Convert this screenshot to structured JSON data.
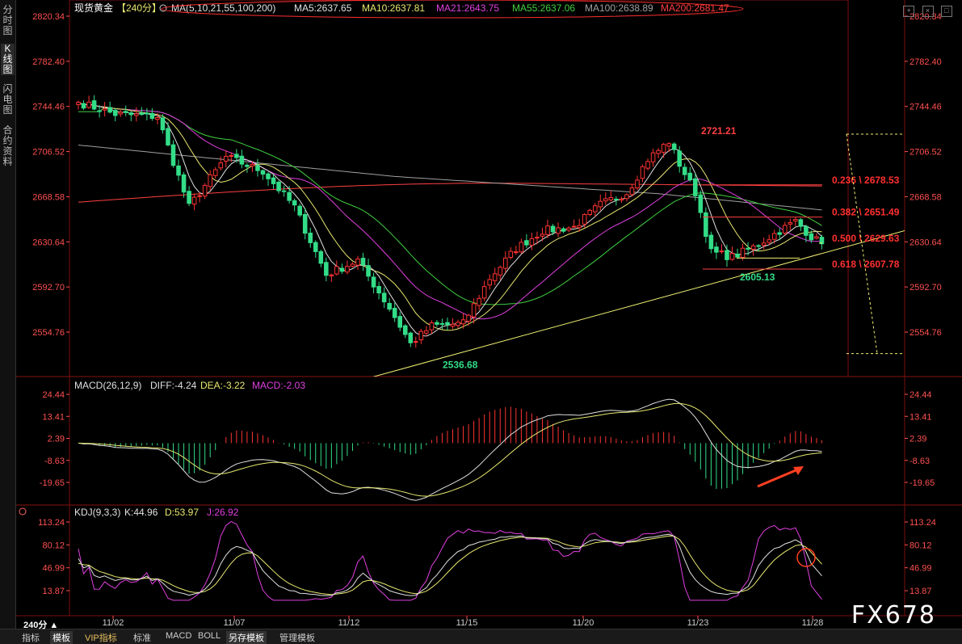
{
  "side_tabs": [
    "分时图",
    "K线图",
    "闪电图",
    "合约资料"
  ],
  "active_side_tab": 1,
  "header": {
    "symbol": "现货黄金",
    "period": "【240分】",
    "ma_label": "MA(5,10,21,55,100,200)",
    "ma_values": [
      {
        "text": "MA5:2637.65",
        "color": "#e0e0e0"
      },
      {
        "text": "MA10:2637.81",
        "color": "#e8e870"
      },
      {
        "text": "MA21:2643.75",
        "color": "#e040e0"
      },
      {
        "text": "MA55:2637.06",
        "color": "#40d040"
      },
      {
        "text": "MA100:2638.89",
        "color": "#a0a0a0"
      },
      {
        "text": "MA200:2681.47",
        "color": "#ff4040"
      }
    ]
  },
  "colors": {
    "up": "#ff3333",
    "down": "#33dd88",
    "axis": "#ff5050",
    "grid": "#7a1010"
  },
  "chart_data": [
    {
      "type": "candlestick",
      "panel": "price",
      "x_ticks": [
        "11/02",
        "11/07",
        "11/12",
        "11/15",
        "11/20",
        "11/23",
        "11/28"
      ],
      "y_ticks": [
        "2820.34",
        "2782.40",
        "2744.46",
        "2706.52",
        "2668.58",
        "2630.64",
        "2592.70",
        "2554.76"
      ],
      "ylim": [
        2536,
        2824
      ],
      "anchors": [
        {
          "i": 0,
          "close": 2748
        },
        {
          "i": 7,
          "close": 2738
        },
        {
          "i": 15,
          "close": 2736
        },
        {
          "i": 21,
          "close": 2660
        },
        {
          "i": 28,
          "close": 2702
        },
        {
          "i": 35,
          "close": 2690
        },
        {
          "i": 41,
          "close": 2660
        },
        {
          "i": 47,
          "close": 2603
        },
        {
          "i": 53,
          "close": 2615
        },
        {
          "i": 59,
          "close": 2575
        },
        {
          "i": 63,
          "close": 2545
        },
        {
          "i": 67,
          "close": 2560
        },
        {
          "i": 73,
          "close": 2562
        },
        {
          "i": 78,
          "close": 2600
        },
        {
          "i": 83,
          "close": 2625
        },
        {
          "i": 88,
          "close": 2640
        },
        {
          "i": 94,
          "close": 2643
        },
        {
          "i": 99,
          "close": 2662
        },
        {
          "i": 104,
          "close": 2672
        },
        {
          "i": 108,
          "close": 2700
        },
        {
          "i": 112,
          "close": 2715
        },
        {
          "i": 114,
          "close": 2696
        },
        {
          "i": 117,
          "close": 2672
        },
        {
          "i": 120,
          "close": 2622
        },
        {
          "i": 124,
          "close": 2618
        },
        {
          "i": 128,
          "close": 2626
        },
        {
          "i": 133,
          "close": 2640
        },
        {
          "i": 136,
          "close": 2648
        },
        {
          "i": 139,
          "close": 2635
        },
        {
          "i": 141,
          "close": 2629
        }
      ],
      "labels": [
        {
          "text": "2721.21",
          "color": "#ff4040"
        },
        {
          "text": "2536.68",
          "color": "#33dd88"
        },
        {
          "text": "2605.13",
          "color": "#33dd88"
        }
      ],
      "fib_levels": [
        {
          "text": "0.236 \\ 2678.53",
          "price": 2678.53
        },
        {
          "text": "0.382 \\ 2651.49",
          "price": 2651.49
        },
        {
          "text": "0.500 \\ 2629.63",
          "price": 2629.63
        },
        {
          "text": "0.618 \\ 2607.78",
          "price": 2607.78
        }
      ],
      "fib_range": [
        2721.21,
        2536.68
      ]
    },
    {
      "type": "line",
      "panel": "macd",
      "title": "MACD(26,12,9)",
      "values_text": [
        {
          "text": "DIFF:-4.24",
          "color": "#e0e0e0"
        },
        {
          "text": "DEA:-3.22",
          "color": "#e8e870"
        },
        {
          "text": "MACD:-2.03",
          "color": "#e040e0"
        }
      ],
      "y_ticks": [
        "24.44",
        "13.41",
        "2.39",
        "-8.63",
        "-19.65"
      ],
      "ylim": [
        -24,
        29
      ]
    },
    {
      "type": "line",
      "panel": "kdj",
      "title": "KDJ(9,3,3)",
      "values_text": [
        {
          "text": "K:44.96",
          "color": "#e0e0e0"
        },
        {
          "text": "D:53.97",
          "color": "#e8e870"
        },
        {
          "text": "J:26.92",
          "color": "#e040e0"
        }
      ],
      "y_ticks": [
        "113.24",
        "80.12",
        "46.99",
        "13.87"
      ],
      "ylim": [
        2,
        118
      ]
    }
  ],
  "bottom_tabs": [
    {
      "label": "240分 ▲",
      "active": false
    },
    {
      "label": "指标",
      "active": false
    },
    {
      "label": "模板",
      "active": true
    },
    {
      "label": "VIP指标",
      "vip": true
    },
    {
      "label": "标准",
      "active": false
    },
    {
      "label": "MACD",
      "active": false
    },
    {
      "label": "BOLL",
      "active": false
    },
    {
      "label": "另存模板",
      "active": true
    },
    {
      "label": "管理模板",
      "active": false
    }
  ],
  "watermark": "FX678"
}
